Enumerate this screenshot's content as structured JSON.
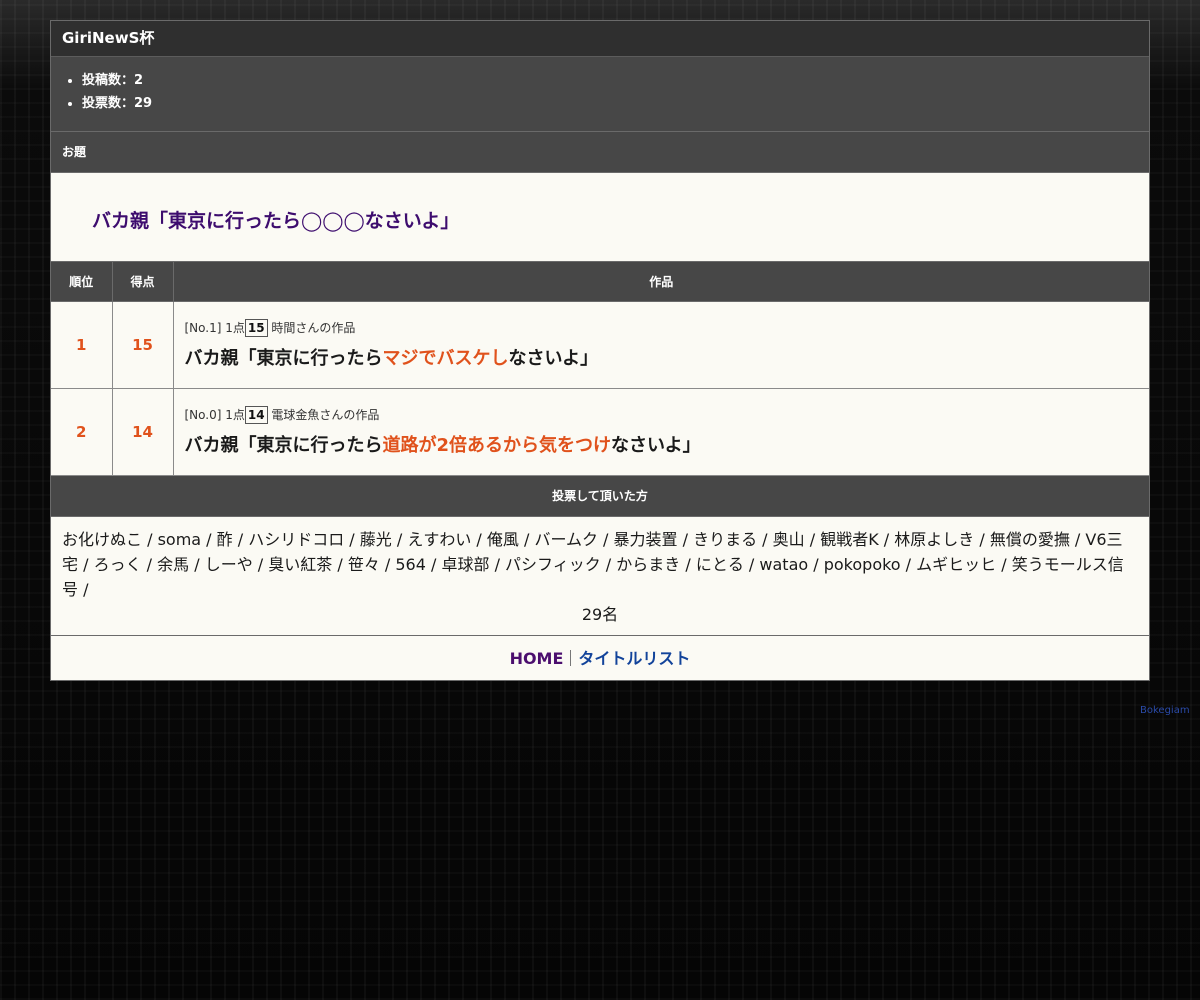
{
  "header": {
    "title": "GiriNewS杯"
  },
  "stats": [
    {
      "label": "投稿数：2"
    },
    {
      "label": "投票数：29"
    }
  ],
  "odai": {
    "section_label": "お題",
    "text": "バカ親「東京に行ったら◯◯◯なさいよ」"
  },
  "table": {
    "headers": {
      "rank": "順位",
      "score": "得点",
      "work": "作品"
    },
    "rows": [
      {
        "rank": "1",
        "score": "15",
        "meta_prefix": "[No.1] 1点",
        "meta_score": "15",
        "meta_author": " 時間さんの作品",
        "entry_before": "バカ親「東京に行ったら",
        "entry_highlight": "マジでバスケし",
        "entry_after": "なさいよ」"
      },
      {
        "rank": "2",
        "score": "14",
        "meta_prefix": "[No.0] 1点",
        "meta_score": "14",
        "meta_author": " 電球金魚さんの作品",
        "entry_before": "バカ親「東京に行ったら",
        "entry_highlight": "道路が2倍あるから気をつけ",
        "entry_after": "なさいよ」"
      }
    ]
  },
  "voters": {
    "section_label": "投票して頂いた方",
    "names": "お化けぬこ / soma / 酢 / ハシリドコロ / 藤光 / えすわい / 俺風 / バームク / 暴力装置 / きりまる / 奥山 / 観戦者K / 林原よしき / 無償の愛撫 / V6三宅 / ろっく / 余馬 / しーや / 臭い紅茶 / 笹々 / 564 / 卓球部 / パシフィック / からまき / にとる / watao / pokopoko / ムギヒッヒ / 笑うモールス信号 /",
    "count": "29名"
  },
  "footer": {
    "home": "HOME",
    "title_list": "タイトルリスト"
  },
  "credit": "Bokegiam",
  "colors": {
    "accent_orange": "#e0521c",
    "odai_purple": "#3d0c6e",
    "link_blue": "#12439a",
    "home_purple": "#4b0e6e"
  }
}
